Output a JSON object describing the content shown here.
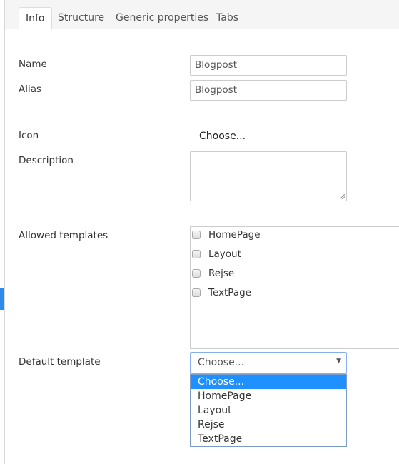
{
  "tabs": [
    {
      "label": "Info",
      "active": true
    },
    {
      "label": "Structure",
      "active": false
    },
    {
      "label": "Generic properties",
      "active": false
    },
    {
      "label": "Tabs",
      "active": false
    }
  ],
  "form": {
    "name": {
      "label": "Name",
      "value": "Blogpost"
    },
    "alias": {
      "label": "Alias",
      "value": "Blogpost"
    },
    "icon": {
      "label": "Icon",
      "action": "Choose..."
    },
    "description": {
      "label": "Description",
      "value": ""
    },
    "allowed_templates": {
      "label": "Allowed templates",
      "items": [
        {
          "label": "HomePage",
          "checked": false
        },
        {
          "label": "Layout",
          "checked": false
        },
        {
          "label": "Rejse",
          "checked": false
        },
        {
          "label": "TextPage",
          "checked": false
        }
      ]
    },
    "default_template": {
      "label": "Default template",
      "selected": "Choose...",
      "options": [
        "Choose...",
        "HomePage",
        "Layout",
        "Rejse",
        "TextPage"
      ],
      "highlighted_index": 0
    }
  },
  "colors": {
    "accent": "#2e8be8",
    "option_highlight": "#1e90ff",
    "focus_border": "#86aef0"
  }
}
